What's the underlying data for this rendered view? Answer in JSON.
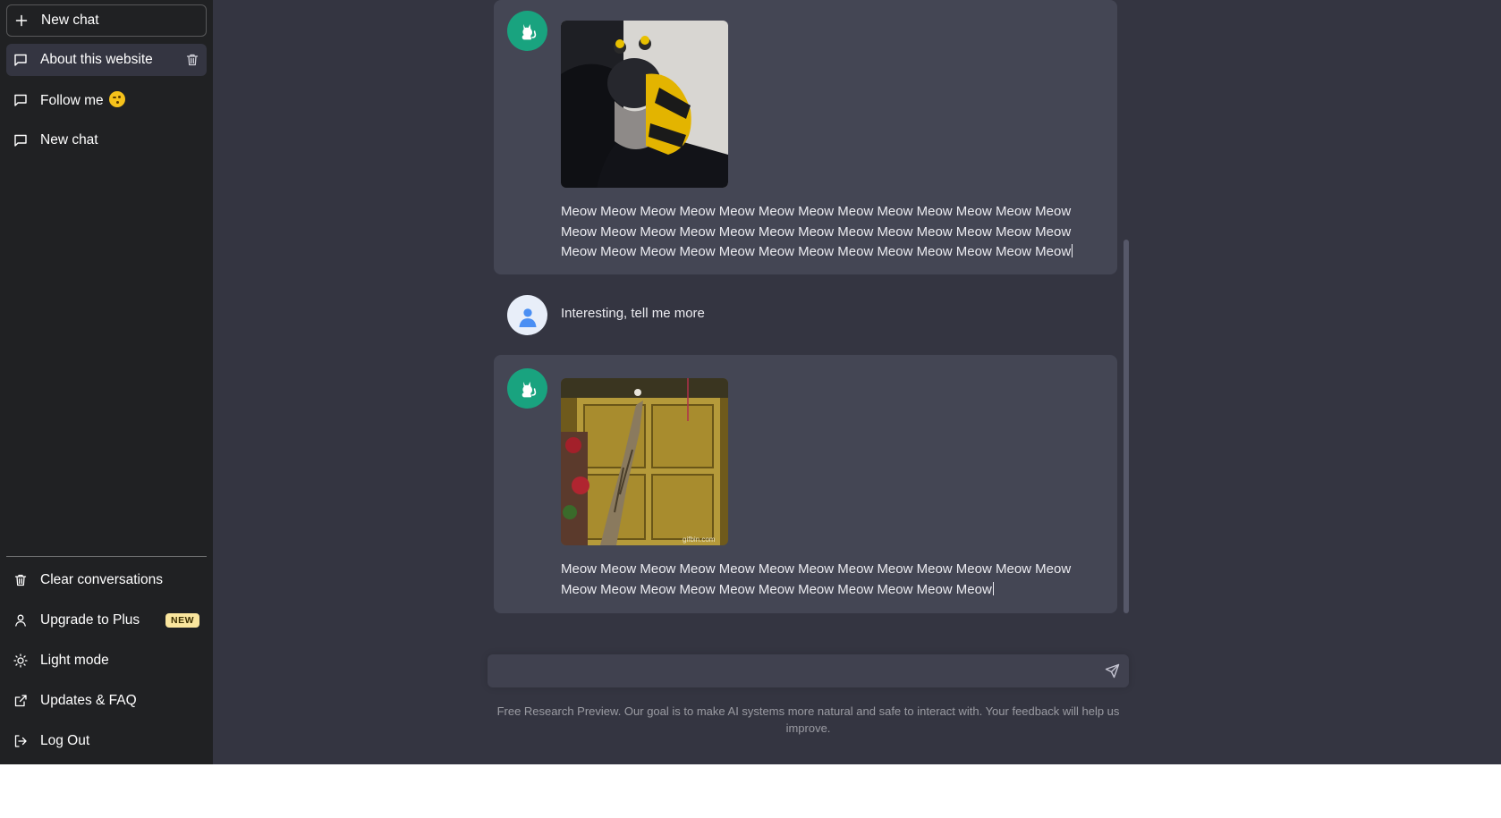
{
  "sidebar": {
    "new_chat_label": "New chat",
    "conversations": [
      {
        "label": "About this website",
        "active": true
      },
      {
        "label": "Follow me",
        "emoji": "winking-face-emoji"
      },
      {
        "label": "New chat"
      }
    ],
    "bottom_items": [
      {
        "label": "Clear conversations",
        "icon": "trash-icon"
      },
      {
        "label": "Upgrade to Plus",
        "icon": "user-icon",
        "badge": "NEW"
      },
      {
        "label": "Light mode",
        "icon": "sun-icon"
      },
      {
        "label": "Updates & FAQ",
        "icon": "external-link-icon"
      },
      {
        "label": "Log Out",
        "icon": "logout-icon"
      }
    ]
  },
  "chat": {
    "messages": [
      {
        "role": "assistant",
        "avatar": "cat-icon",
        "image": "cat-in-bee-costume",
        "text": "Meow Meow Meow Meow Meow Meow Meow Meow Meow Meow Meow Meow Meow Meow Meow Meow Meow Meow Meow Meow Meow Meow Meow Meow Meow Meow Meow Meow Meow Meow Meow Meow Meow Meow Meow Meow Meow Meow Meow"
      },
      {
        "role": "user",
        "avatar": "user-avatar-icon",
        "text": "Interesting, tell me more"
      },
      {
        "role": "assistant",
        "avatar": "cat-icon",
        "image": "cat-climbing-cabinet",
        "image_watermark": "gifbin.com",
        "text": "Meow Meow Meow Meow Meow Meow Meow Meow Meow Meow Meow Meow Meow Meow Meow Meow Meow Meow Meow Meow Meow Meow Meow Meow"
      }
    ]
  },
  "composer": {
    "value": "",
    "send_icon": "send-icon"
  },
  "footer_note": "Free Research Preview. Our goal is to make AI systems more natural and safe to interact with. Your feedback will help us improve.",
  "colors": {
    "sidebar_bg": "#202123",
    "main_bg": "#343541",
    "assistant_card_bg": "#444654",
    "avatar_green": "#19a37f",
    "badge_bg": "#fae69e"
  }
}
